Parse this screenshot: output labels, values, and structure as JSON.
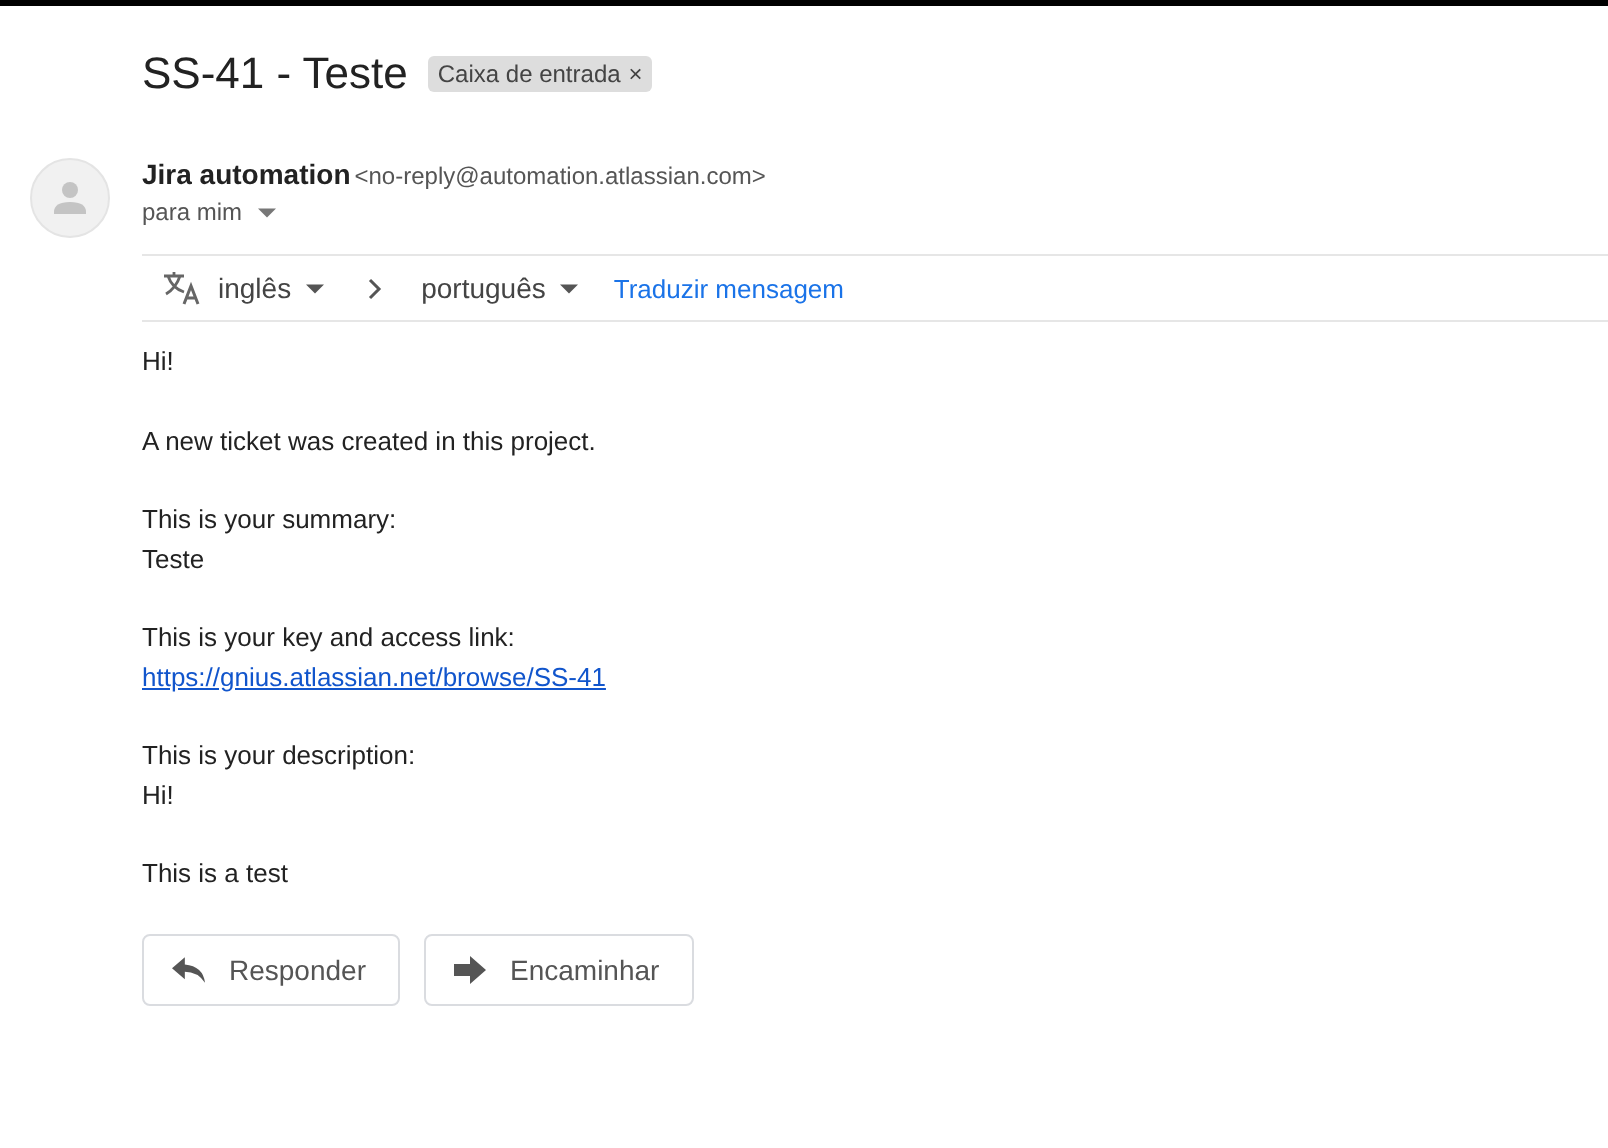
{
  "subject": "SS-41 - Teste",
  "label_chip": {
    "text": "Caixa de entrada",
    "close": "×"
  },
  "sender": {
    "name": "Jira automation",
    "email": "<no-reply@automation.atlassian.com>",
    "recipient": "para mim"
  },
  "translate_bar": {
    "source_language": "inglês",
    "target_language": "português",
    "action": "Traduzir mensagem"
  },
  "body": [
    {
      "lines": [
        {
          "kind": "text",
          "text": "Hi!"
        }
      ]
    },
    {
      "lines": [
        {
          "kind": "text",
          "text": "A new ticket was created in this project."
        }
      ]
    },
    {
      "lines": [
        {
          "kind": "text",
          "text": "This is your summary:"
        },
        {
          "kind": "text",
          "text": "Teste"
        }
      ]
    },
    {
      "lines": [
        {
          "kind": "text",
          "text": "This is your key and access link:"
        },
        {
          "kind": "link",
          "text": "https://gnius.atlassian.net/browse/SS-41"
        }
      ]
    },
    {
      "lines": [
        {
          "kind": "text",
          "text": "This is your description:"
        },
        {
          "kind": "text",
          "text": "Hi!"
        }
      ]
    },
    {
      "lines": [
        {
          "kind": "text",
          "text": "This is a test"
        }
      ]
    }
  ],
  "actions": [
    {
      "kind": "reply",
      "label": "Responder"
    },
    {
      "kind": "forward",
      "label": "Encaminhar"
    }
  ]
}
